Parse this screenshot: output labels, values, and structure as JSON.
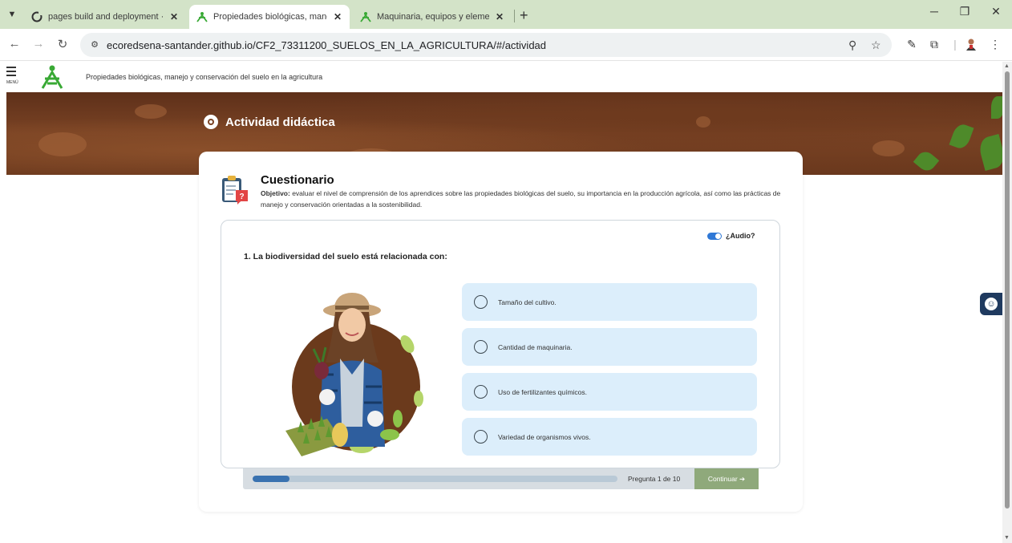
{
  "browser": {
    "tabs": [
      {
        "title": "pages build and deployment · ECC",
        "active": false
      },
      {
        "title": "Propiedades biológicas, manejo y",
        "active": true
      },
      {
        "title": "Maquinaria, equipos y elementos",
        "active": false
      }
    ],
    "url": "ecoredsena-santander.github.io/CF2_73311200_SUELOS_EN_LA_AGRICULTURA/#/actividad"
  },
  "header": {
    "menu_label": "MENÚ",
    "course_title": "Propiedades biológicas, manejo y conservación del suelo en la agricultura"
  },
  "banner": {
    "title": "Actividad didáctica"
  },
  "quiz": {
    "title": "Cuestionario",
    "objective_label": "Objetivo:",
    "objective_text": " evaluar el nivel de comprensión de los aprendices sobre las propiedades biológicas del suelo, su importancia en la producción agrícola, así como las prácticas de manejo y conservación orientadas a la sostenibilidad.",
    "audio_label": "¿Audio?",
    "audio_on": true,
    "question": "1. La biodiversidad del suelo está relacionada con:",
    "options": [
      "Tamaño del cultivo.",
      "Cantidad de maquinaria.",
      "Uso de fertilizantes químicos.",
      "Variedad de organismos vivos."
    ],
    "progress_fraction": 0.1,
    "progress_text": "Pregunta 1 de 10",
    "continue_label": "Continuar ➔"
  },
  "colors": {
    "tabbar": "#d3e3c8",
    "option_bg": "#dceefb",
    "progress_fill": "#3a72b0",
    "continue_bg": "#8fa97b",
    "toggle": "#2f78d6",
    "banner_soil": "#6e3a1e"
  }
}
